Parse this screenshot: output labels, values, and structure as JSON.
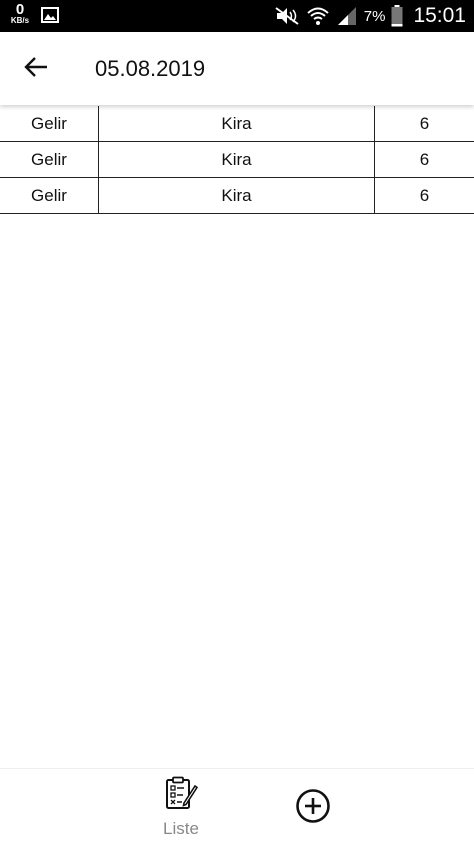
{
  "status_bar": {
    "net_speed": "0",
    "net_unit": "KB/s",
    "battery": "7%",
    "time": "15:01"
  },
  "header": {
    "title": "05.08.2019",
    "back_icon": "arrow-left-icon"
  },
  "table": {
    "rows": [
      [
        "Gelir",
        "Kira",
        "6"
      ],
      [
        "Gelir",
        "Kira",
        "6"
      ],
      [
        "Gelir",
        "Kira",
        "6"
      ]
    ]
  },
  "bottom_nav": {
    "list_label": "Liste",
    "list_icon": "clipboard-checklist-icon",
    "add_icon": "plus-circle-icon"
  }
}
